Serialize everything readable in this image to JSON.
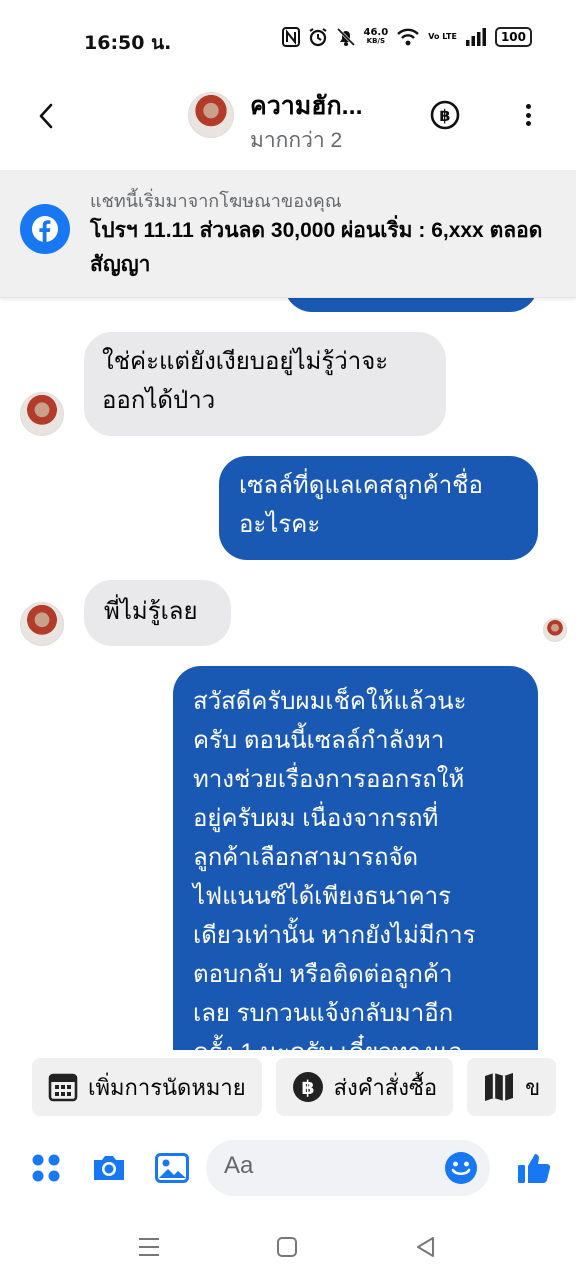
{
  "status_bar": {
    "time": "16:50 น.",
    "net_speed_value": "46.0",
    "net_speed_unit": "KB/S",
    "volte": "Vo LTE",
    "battery": "100"
  },
  "header": {
    "contact_name": "ความฮัก...",
    "subtitle": "มากกว่า 2"
  },
  "ad_banner": {
    "notice": "แชทนี้เริ่มมาจากโฆษณาของคุณ",
    "ad_title": "โปรฯ 11.11 ส่วนลด 30,000 ผ่อนเริ่ม : 6,xxx ตลอดสัญญา"
  },
  "messages": [
    {
      "from": "them",
      "text": "ใช่ค่ะแต่ยังเงียบอยู่ไม่รู้ว่าจะออกได้ป่าว"
    },
    {
      "from": "me",
      "text": "เซลล์ที่ดูแลเคสลูกค้าชื่ออะไรคะ"
    },
    {
      "from": "them",
      "text": "พี่ไม่รู้เลย"
    },
    {
      "from": "me",
      "text": "สวัสดีครับผมเช็คให้แล้วนะครับ ตอนนี้เซลล์กำลังหาทางช่วยเรื่องการออกรถให้อยู่ครับผม เนื่องจากรถที่ลูกค้าเลือกสามารถจัดไฟแนนซ์ได้เพียงธนาคารเดียวเท่านั้น หากยังไม่มีการตอบกลับ หรือติดต่อลูกค้าเลย รบกวนแจ้งกลับมาอีกครั้ง 1 นะครับ เดี๋ยวทางแอ"
    }
  ],
  "message_lines": {
    "m1": [
      "ใช่ค่ะแต่ยังเงียบอยู่ไม่รู้ว่าจะ",
      "ออกได้ป่าว"
    ],
    "m2": [
      "เซลล์ที่ดูแลเคสลูกค้าชื่อ",
      "อะไรคะ"
    ],
    "m3": [
      "พี่ไม่รู้เลย"
    ],
    "m4": [
      "สวัสดีครับผมเช็คให้แล้วนะ",
      "ครับ ตอนนี้เซลล์กำลังหา",
      "ทางช่วยเรื่องการออกรถให้",
      "อยู่ครับผม เนื่องจากรถที่",
      "ลูกค้าเลือกสามารถจัด",
      "ไฟแนนซ์ได้เพียงธนาคาร",
      "เดียวเท่านั้น หากยังไม่มีการ",
      "ตอบกลับ หรือติดต่อลูกค้า",
      "เลย รบกวนแจ้งกลับมาอีก",
      "ครั้ง 1 นะครับ เดี๋ยวทางแอ"
    ]
  },
  "quick_actions": [
    {
      "label": "เพิ่มการนัดหมาย",
      "icon": "calendar-icon"
    },
    {
      "label": "ส่งคำสั่งซื้อ",
      "icon": "baht-icon"
    },
    {
      "label": "ข",
      "icon": "map-icon"
    }
  ],
  "composer": {
    "placeholder": "Aa"
  },
  "colors": {
    "outgoing_bubble": "#1959b4",
    "incoming_bubble": "#e9e9eb",
    "accent": "#1877f2"
  }
}
